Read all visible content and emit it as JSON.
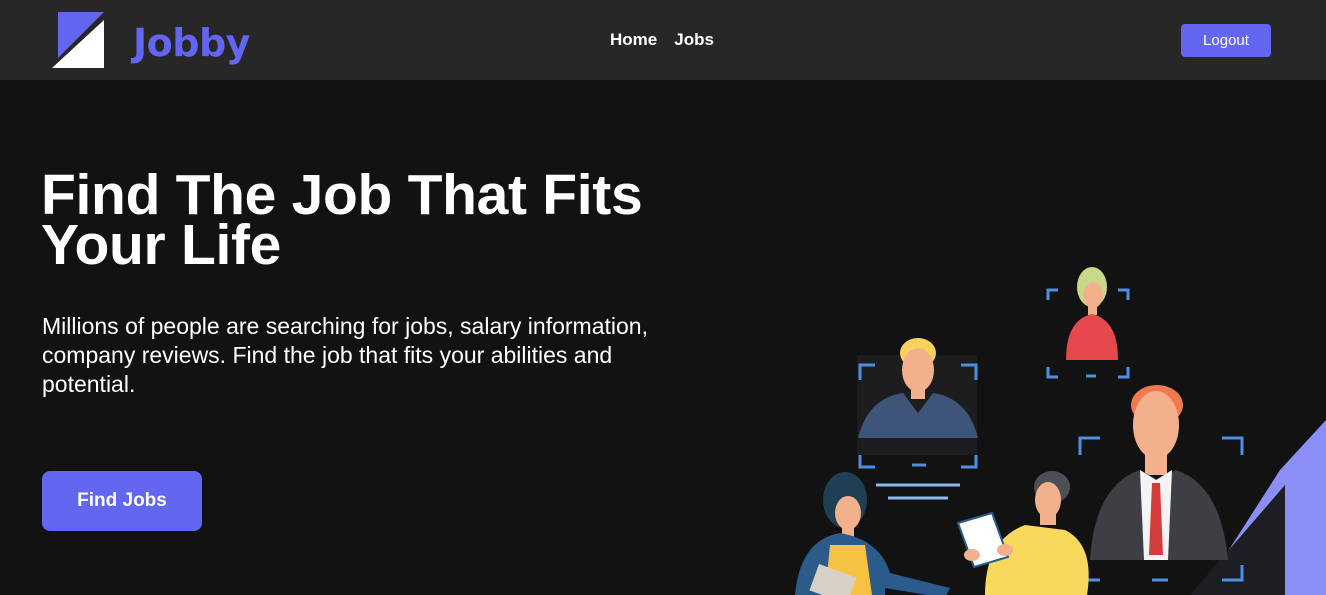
{
  "navbar": {
    "logo_text": "Jobby",
    "logo_icon": "jobby-logo-icon",
    "links": [
      {
        "label": "Home"
      },
      {
        "label": "Jobs"
      }
    ],
    "logout_label": "Logout"
  },
  "hero": {
    "title": "Find The Job That Fits Your Life",
    "description": "Millions of people are searching for jobs, salary information, company reviews. Find the job that fits your abilities and potential.",
    "cta_label": "Find Jobs"
  },
  "colors": {
    "accent": "#6366f1",
    "navbar_bg": "#272727",
    "page_bg": "#121212",
    "text": "#ffffff"
  },
  "illustration": {
    "icon": "job-seekers-illustration"
  }
}
